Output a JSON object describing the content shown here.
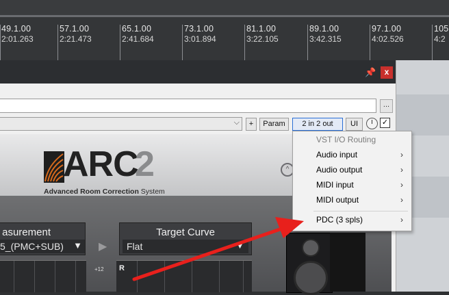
{
  "ruler": {
    "markers": [
      {
        "bar": "49.1.00",
        "time": "2:01.263"
      },
      {
        "bar": "57.1.00",
        "time": "2:21.473"
      },
      {
        "bar": "65.1.00",
        "time": "2:41.684"
      },
      {
        "bar": "73.1.00",
        "time": "3:01.894"
      },
      {
        "bar": "81.1.00",
        "time": "3:22.105"
      },
      {
        "bar": "89.1.00",
        "time": "3:42.315"
      },
      {
        "bar": "97.1.00",
        "time": "4:02.526"
      },
      {
        "bar": "105",
        "time": "4:2"
      }
    ]
  },
  "fx_window": {
    "pin_glyph": "📌",
    "close_glyph": "x",
    "browse_label": "...",
    "toolbar": {
      "add_label": "+",
      "param_label": "Param",
      "io_label": "2 in 2 out",
      "ui_label": "UI",
      "bypass_check": "✓"
    }
  },
  "plugin": {
    "logo_main": "ARC",
    "logo_num": "2",
    "logo_sub_bold": "Advanced Room Correction",
    "logo_sub_rest": " System",
    "measurement_label": "asurement",
    "measurement_value": "5_(PMC+SUB)",
    "target_label": "Target Curve",
    "target_value": "Flat",
    "gain_label": "+12",
    "graph_channel": "R"
  },
  "context_menu": {
    "header": "VST I/O Routing",
    "items": [
      {
        "label": "Audio input"
      },
      {
        "label": "Audio output"
      },
      {
        "label": "MIDI input"
      },
      {
        "label": "MIDI output"
      }
    ],
    "pdc": {
      "label": "PDC (3 spls)"
    }
  },
  "colors": {
    "annotation_arrow": "#e8201c",
    "close_button": "#c8302c",
    "io_button_border": "#2a6fd6"
  }
}
